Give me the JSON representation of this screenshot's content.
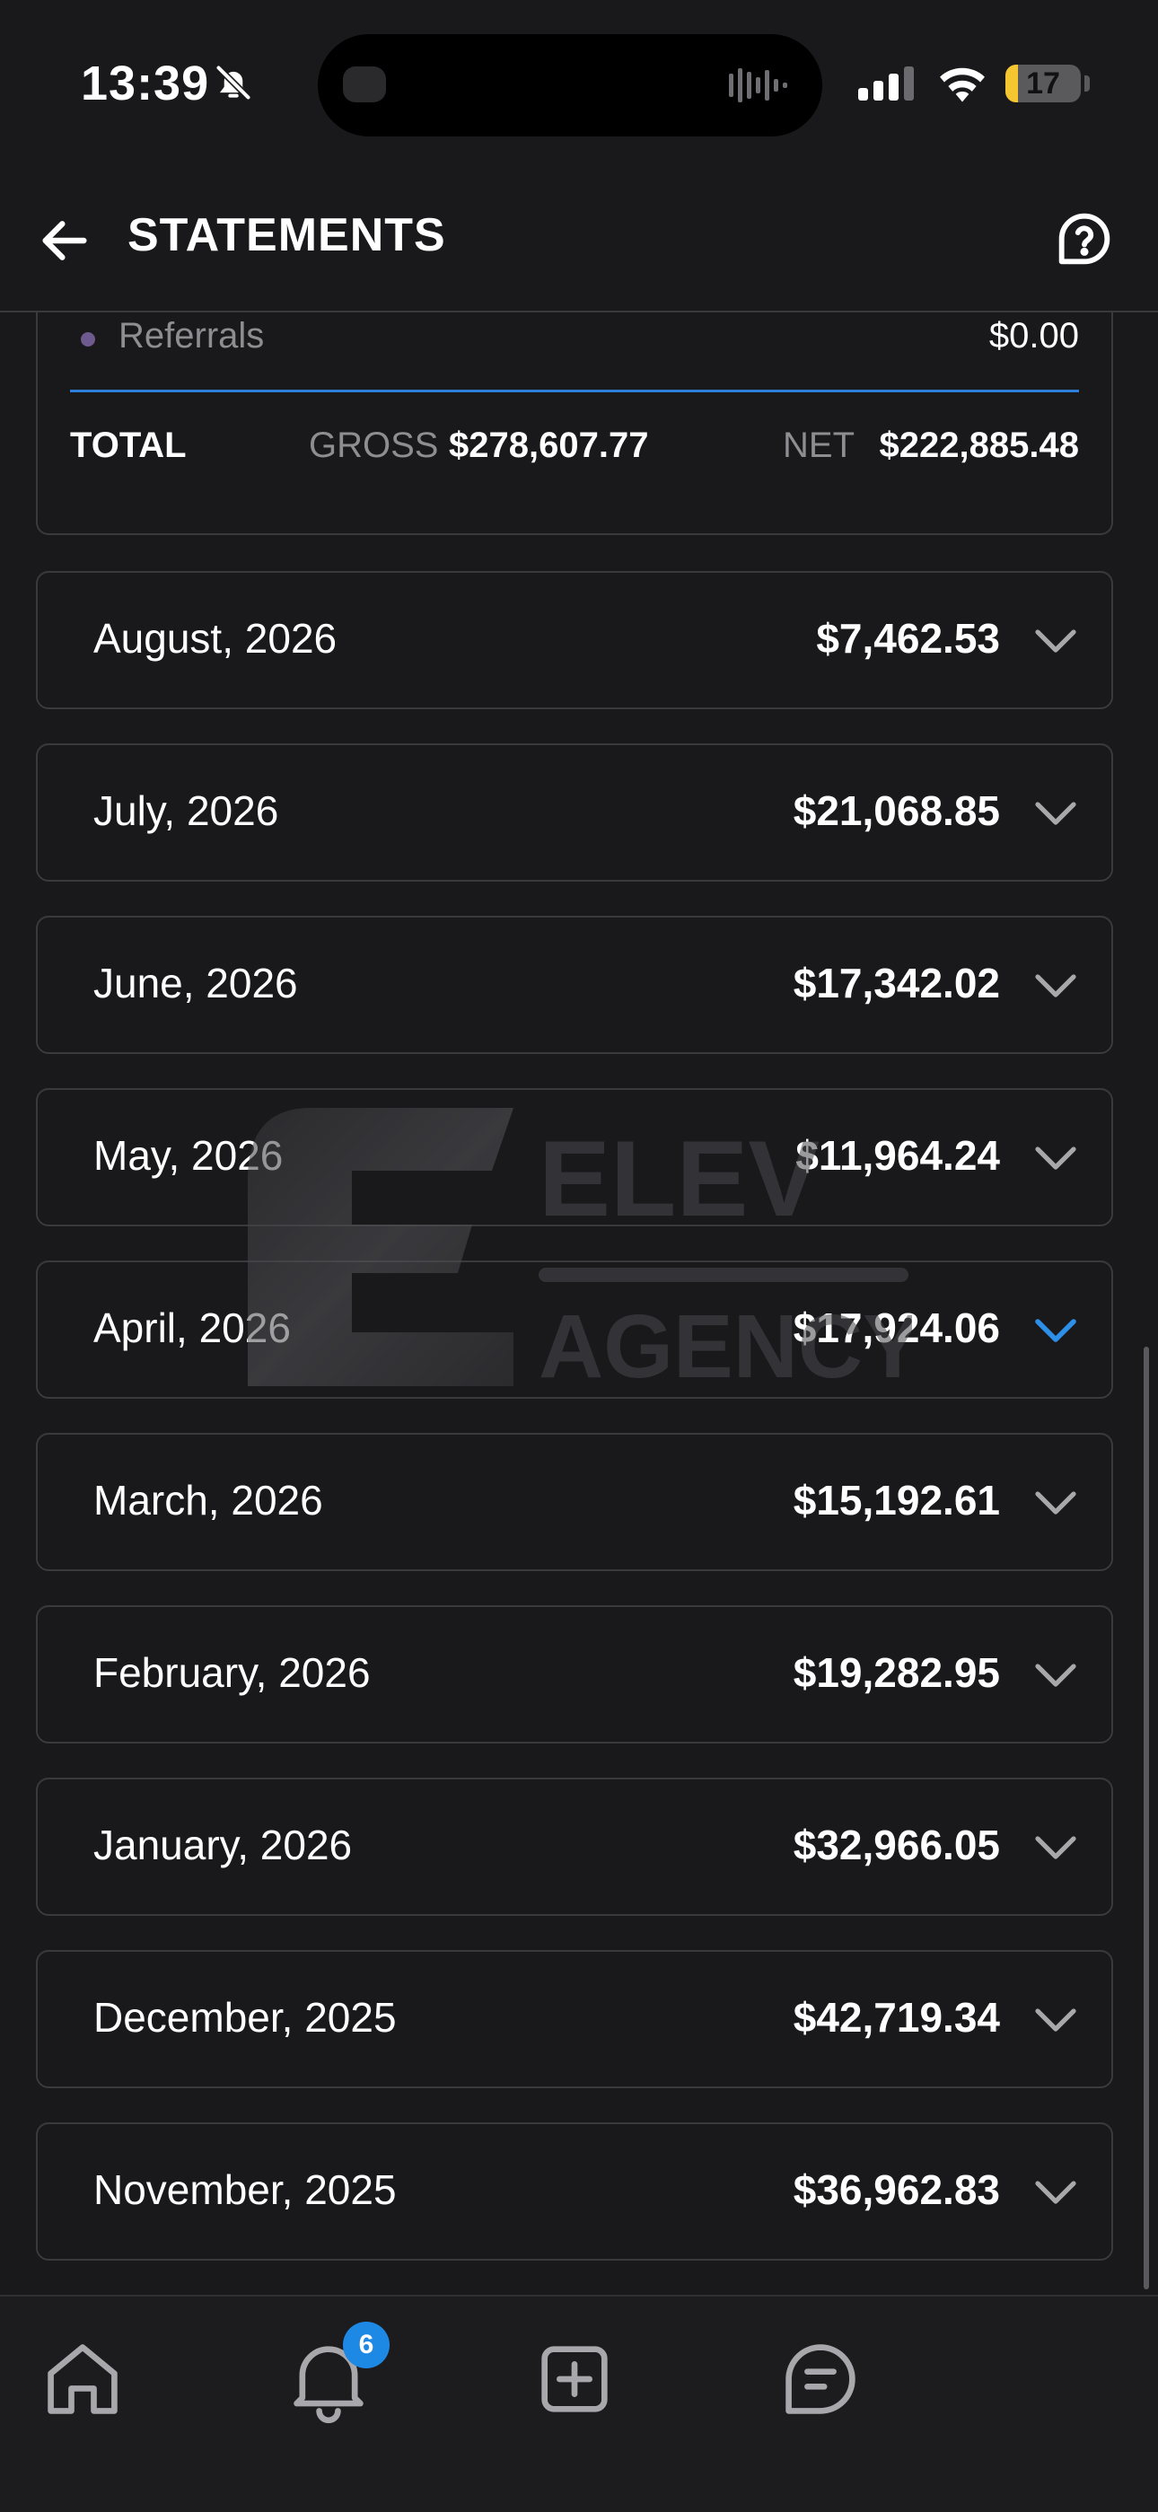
{
  "status_bar": {
    "time": "13:39",
    "battery": "17",
    "battery_level": 0.17
  },
  "header": {
    "title": "STATEMENTS"
  },
  "summary": {
    "referrals_label": "Referrals",
    "referrals_value": "$0.00",
    "total_label": "TOTAL",
    "gross_label": "GROSS",
    "gross_value": "$278,607.77",
    "net_label": "NET",
    "net_value": "$222,885.48"
  },
  "months": [
    {
      "label": "August, 2026",
      "amount": "$7,462.53"
    },
    {
      "label": "July, 2026",
      "amount": "$21,068.85"
    },
    {
      "label": "June, 2026",
      "amount": "$17,342.02"
    },
    {
      "label": "May, 2026",
      "amount": "$11,964.24"
    },
    {
      "label": "April, 2026",
      "amount": "$17,924.06"
    },
    {
      "label": "March, 2026",
      "amount": "$15,192.61"
    },
    {
      "label": "February, 2026",
      "amount": "$19,282.95"
    },
    {
      "label": "January, 2026",
      "amount": "$32,966.05"
    },
    {
      "label": "December, 2025",
      "amount": "$42,719.34"
    },
    {
      "label": "November, 2025",
      "amount": "$36,962.83"
    }
  ],
  "watermark": {
    "line1": "ELEV",
    "line2": "AGENCY"
  },
  "tab_bar": {
    "notifications_badge": "6"
  },
  "colors": {
    "background": "#19191b",
    "accent": "#2e7fd9",
    "badge": "#1e88e5",
    "battery": "#f6c630"
  },
  "icons": [
    "bell-off-icon",
    "signal-icon",
    "wifi-icon",
    "back-arrow-icon",
    "help-icon",
    "chevron-down-icon",
    "home-icon",
    "notification-bell-icon",
    "add-square-icon",
    "chat-icon"
  ]
}
